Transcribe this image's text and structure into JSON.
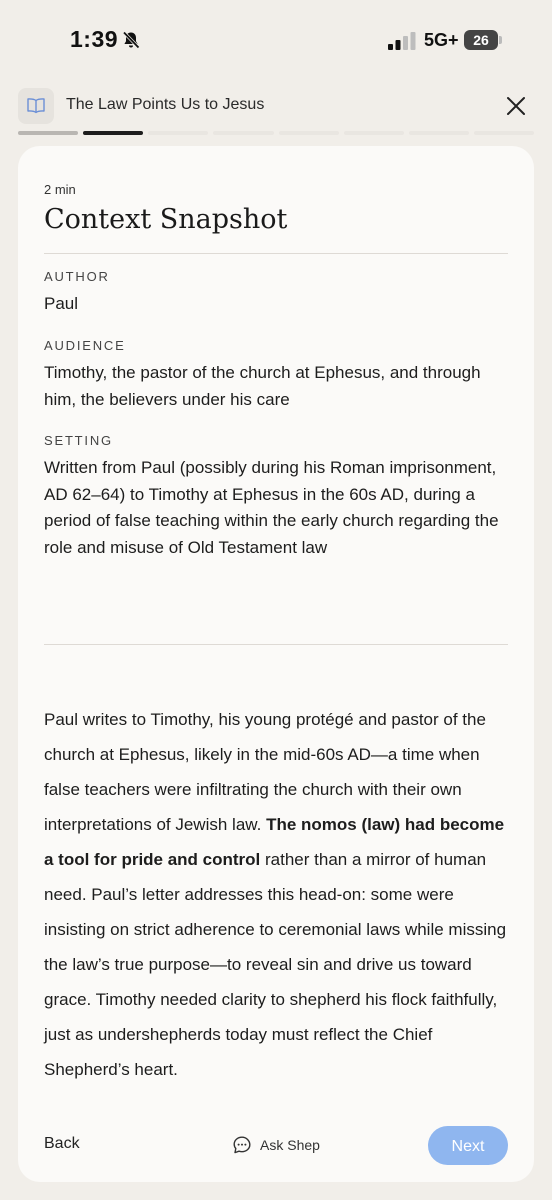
{
  "status_bar": {
    "time": "1:39",
    "network": "5G+",
    "battery": "26"
  },
  "header": {
    "title": "The Law Points Us to Jesus"
  },
  "progress": {
    "total_segments": 8,
    "completed_segments": 1,
    "active_segment": 2
  },
  "card": {
    "read_time": "2 min",
    "title": "Context Snapshot",
    "sections": [
      {
        "label": "AUTHOR",
        "value": "Paul"
      },
      {
        "label": "AUDIENCE",
        "value": "Timothy, the pastor of the church at Ephesus, and through him, the believers under his care"
      },
      {
        "label": "SETTING",
        "value": "Written from Paul (possibly during his Roman imprisonment, AD 62–64) to Timothy at Ephesus in the 60s AD, during a period of false teaching within the early church regarding the role and misuse of Old Testament law"
      }
    ],
    "body": {
      "part1": "Paul writes to Timothy, his young protégé and pastor of the church at Ephesus, likely in the mid-60s AD—a time when false teachers were infiltrating the church with their own interpretations of Jewish law. ",
      "bold": "The nomos (law) had become a tool for pride and control",
      "part2": " rather than a mirror of human need. Paul’s letter addresses this head-on: some were insisting on strict adherence to ceremonial laws while missing the law’s true purpose—to reveal sin and drive us toward grace. Timothy needed clarity to shepherd his flock faithfully, just as undershepherds today must reflect the Chief Shepherd’s heart."
    }
  },
  "footer": {
    "back_label": "Back",
    "ask_label": "Ask Shep",
    "next_label": "Next"
  },
  "colors": {
    "background": "#f1eee9",
    "card": "#fbfaf8",
    "accent_button": "#8fb6ef",
    "book_icon": "#6b8fd6"
  },
  "icons": [
    "bell-off-icon",
    "signal-icon",
    "book-icon",
    "close-icon",
    "chat-bubble-icon"
  ]
}
